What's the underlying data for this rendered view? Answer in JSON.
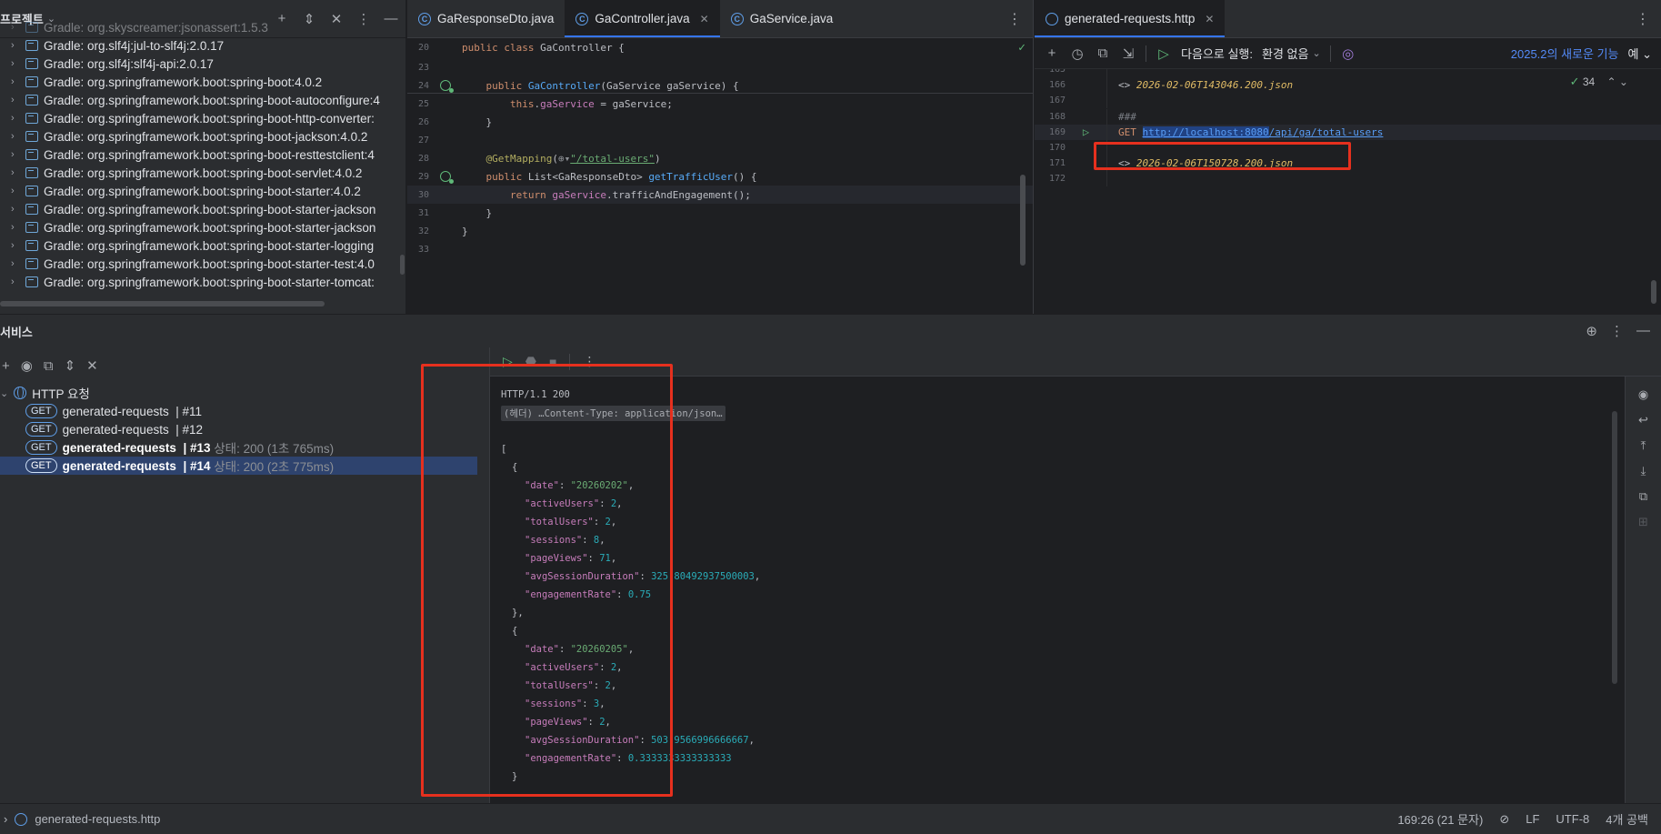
{
  "project_panel": {
    "title": "프로젝트",
    "truncated_top_item": "Gradle: org.skyscreamer:jsonassert:1.5.3",
    "items": [
      "Gradle: org.slf4j:jul-to-slf4j:2.0.17",
      "Gradle: org.slf4j:slf4j-api:2.0.17",
      "Gradle: org.springframework.boot:spring-boot:4.0.2",
      "Gradle: org.springframework.boot:spring-boot-autoconfigure:4",
      "Gradle: org.springframework.boot:spring-boot-http-converter:",
      "Gradle: org.springframework.boot:spring-boot-jackson:4.0.2",
      "Gradle: org.springframework.boot:spring-boot-resttestclient:4",
      "Gradle: org.springframework.boot:spring-boot-servlet:4.0.2",
      "Gradle: org.springframework.boot:spring-boot-starter:4.0.2",
      "Gradle: org.springframework.boot:spring-boot-starter-jackson",
      "Gradle: org.springframework.boot:spring-boot-starter-jackson",
      "Gradle: org.springframework.boot:spring-boot-starter-logging",
      "Gradle: org.springframework.boot:spring-boot-starter-test:4.0",
      "Gradle: org.springframework.boot:spring-boot-starter-tomcat:"
    ]
  },
  "editor_left": {
    "tabs": [
      {
        "label": "GaResponseDto.java",
        "active": false
      },
      {
        "label": "GaController.java",
        "active": true
      },
      {
        "label": "GaService.java",
        "active": false
      }
    ],
    "sticky": {
      "line": "20",
      "text": "public class GaController {"
    },
    "lines": [
      {
        "n": "23",
        "text": ""
      },
      {
        "n": "24",
        "text": "    public GaController(GaService gaService) {"
      },
      {
        "n": "25",
        "text": "        this.gaService = gaService;"
      },
      {
        "n": "26",
        "text": "    }"
      },
      {
        "n": "27",
        "text": ""
      },
      {
        "n": "28",
        "text": "    @GetMapping(\"/total-users\")"
      },
      {
        "n": "29",
        "text": "    public List<GaResponseDto> getTrafficUser() {"
      },
      {
        "n": "30",
        "text": "        return gaService.trafficAndEngagement();"
      },
      {
        "n": "31",
        "text": "    }"
      },
      {
        "n": "32",
        "text": "}"
      },
      {
        "n": "33",
        "text": ""
      }
    ]
  },
  "editor_right": {
    "tab": "generated-requests.http",
    "toolbar": {
      "run_with_label": "다음으로 실행:",
      "env_label": "환경 없음",
      "new_features": "2025.2의 새로운 기능",
      "yes_label": "예"
    },
    "inspection_count": "34",
    "lines": [
      {
        "n": "165",
        "text": ""
      },
      {
        "n": "166",
        "prefix": "<> ",
        "file": "2026-02-06T143046.200.json"
      },
      {
        "n": "167",
        "text": ""
      },
      {
        "n": "168",
        "comment": "###"
      },
      {
        "n": "169",
        "method": "GET",
        "host": "http://localhost:8080",
        "path": "/api/ga/total-users"
      },
      {
        "n": "170",
        "text": ""
      },
      {
        "n": "171",
        "prefix": "<> ",
        "file": "2026-02-06T150728.200.json"
      },
      {
        "n": "172",
        "text": ""
      }
    ]
  },
  "services": {
    "title": "서비스",
    "group_label": "HTTP 요청",
    "requests": [
      {
        "method": "GET",
        "name": "generated-requests",
        "num": "| #11",
        "status": "",
        "bold": false,
        "selected": false
      },
      {
        "method": "GET",
        "name": "generated-requests",
        "num": "| #12",
        "status": "",
        "bold": false,
        "selected": false
      },
      {
        "method": "GET",
        "name": "generated-requests",
        "num": "| #13",
        "status": "상태: 200 (1초 765ms)",
        "bold": true,
        "selected": false
      },
      {
        "method": "GET",
        "name": "generated-requests",
        "num": "| #14",
        "status": "상태: 200 (2초 775ms)",
        "bold": true,
        "selected": true
      }
    ],
    "response": {
      "status_line": "HTTP/1.1 200",
      "headers_fold": "(헤더) …Content-Type: application/json…",
      "items": [
        {
          "date": "\"20260202\"",
          "activeUsers": "2",
          "totalUsers": "2",
          "sessions": "8",
          "pageViews": "71",
          "avgSessionDuration": "325.80492937500003",
          "engagementRate": "0.75"
        },
        {
          "date": "\"20260205\"",
          "activeUsers": "2",
          "totalUsers": "2",
          "sessions": "3",
          "pageViews": "2",
          "avgSessionDuration": "503.9566996666667",
          "engagementRate": "0.3333333333333333"
        }
      ]
    }
  },
  "status_bar": {
    "file": "generated-requests.http",
    "position": "169:26 (21 문자)",
    "line_sep": "LF",
    "encoding": "UTF-8",
    "indent": "4개 공백"
  },
  "colors": {
    "accent": "#3574f0",
    "highlight_box": "#e6301e"
  }
}
